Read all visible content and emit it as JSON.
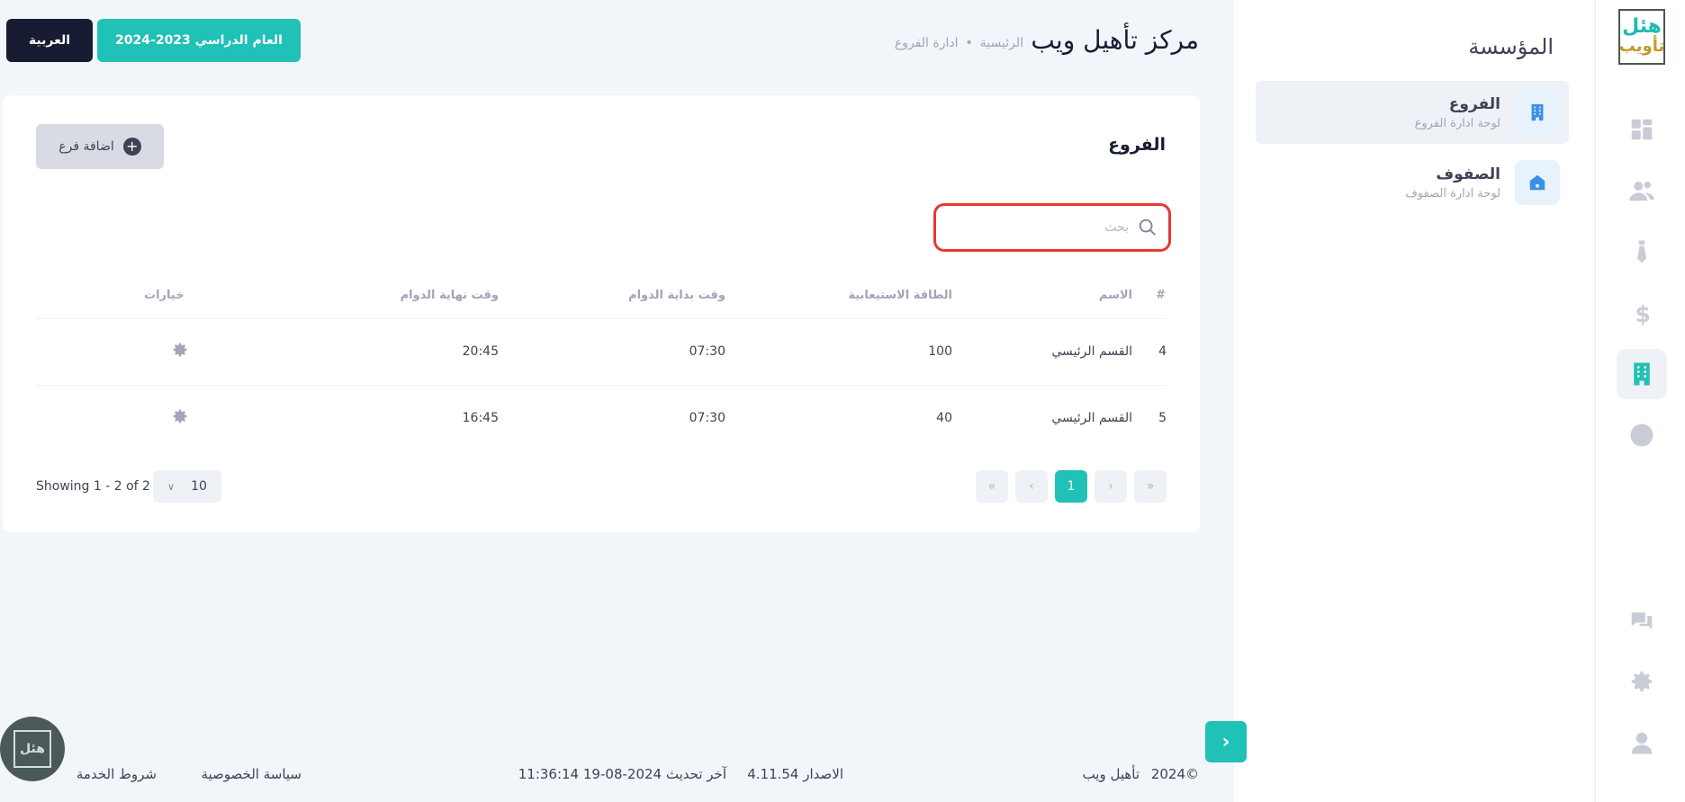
{
  "app": {
    "title": "مركز تأهيل ويب",
    "breadcrumb": [
      "الرئيسية",
      "ادارة الفروع"
    ],
    "year_button": "العام الدراسي 2023-2024",
    "language_button": "العربية",
    "logo": {
      "line1": "هئل",
      "line2": "تأويب"
    }
  },
  "sidebar": {
    "title": "المؤسسة",
    "items": [
      {
        "label": "الفروع",
        "subtitle": "لوحة ادارة الفروع",
        "icon": "building-icon"
      },
      {
        "label": "الصفوف",
        "subtitle": "لوحة ادارة الصفوف",
        "icon": "house-icon"
      }
    ]
  },
  "card": {
    "title": "الفروع",
    "add_button": "اضافة فرع",
    "search_placeholder": "بحث",
    "columns": [
      "#",
      "الاسم",
      "الطاقة الاستيعابية",
      "وقت بداية الدوام",
      "وقت نهاية الدوام",
      "خيارات"
    ],
    "rows": [
      {
        "id": "4",
        "name": "القسم الرئيسي",
        "capacity": "100",
        "start": "07:30",
        "end": "20:45"
      },
      {
        "id": "5",
        "name": "القسم الرئيسي",
        "capacity": "40",
        "start": "07:30",
        "end": "16:45"
      }
    ],
    "pagination": {
      "first": "«",
      "prev": "‹",
      "current": "1",
      "next": "›",
      "last": "»"
    },
    "showing": "Showing 1 - 2 of 2",
    "per_page": "10"
  },
  "footer": {
    "copyright": "©2024",
    "brand": "تأهيل ويب",
    "version": "الاصدار 4.11.54",
    "last_update": "آخر تحديث 2024-08-19 11:36:14",
    "privacy": "سياسة الخصوصية",
    "terms": "شروط الخدمة"
  },
  "colors": {
    "accent": "#20c1b6",
    "dark": "#181c32",
    "highlight": "#e53935"
  }
}
